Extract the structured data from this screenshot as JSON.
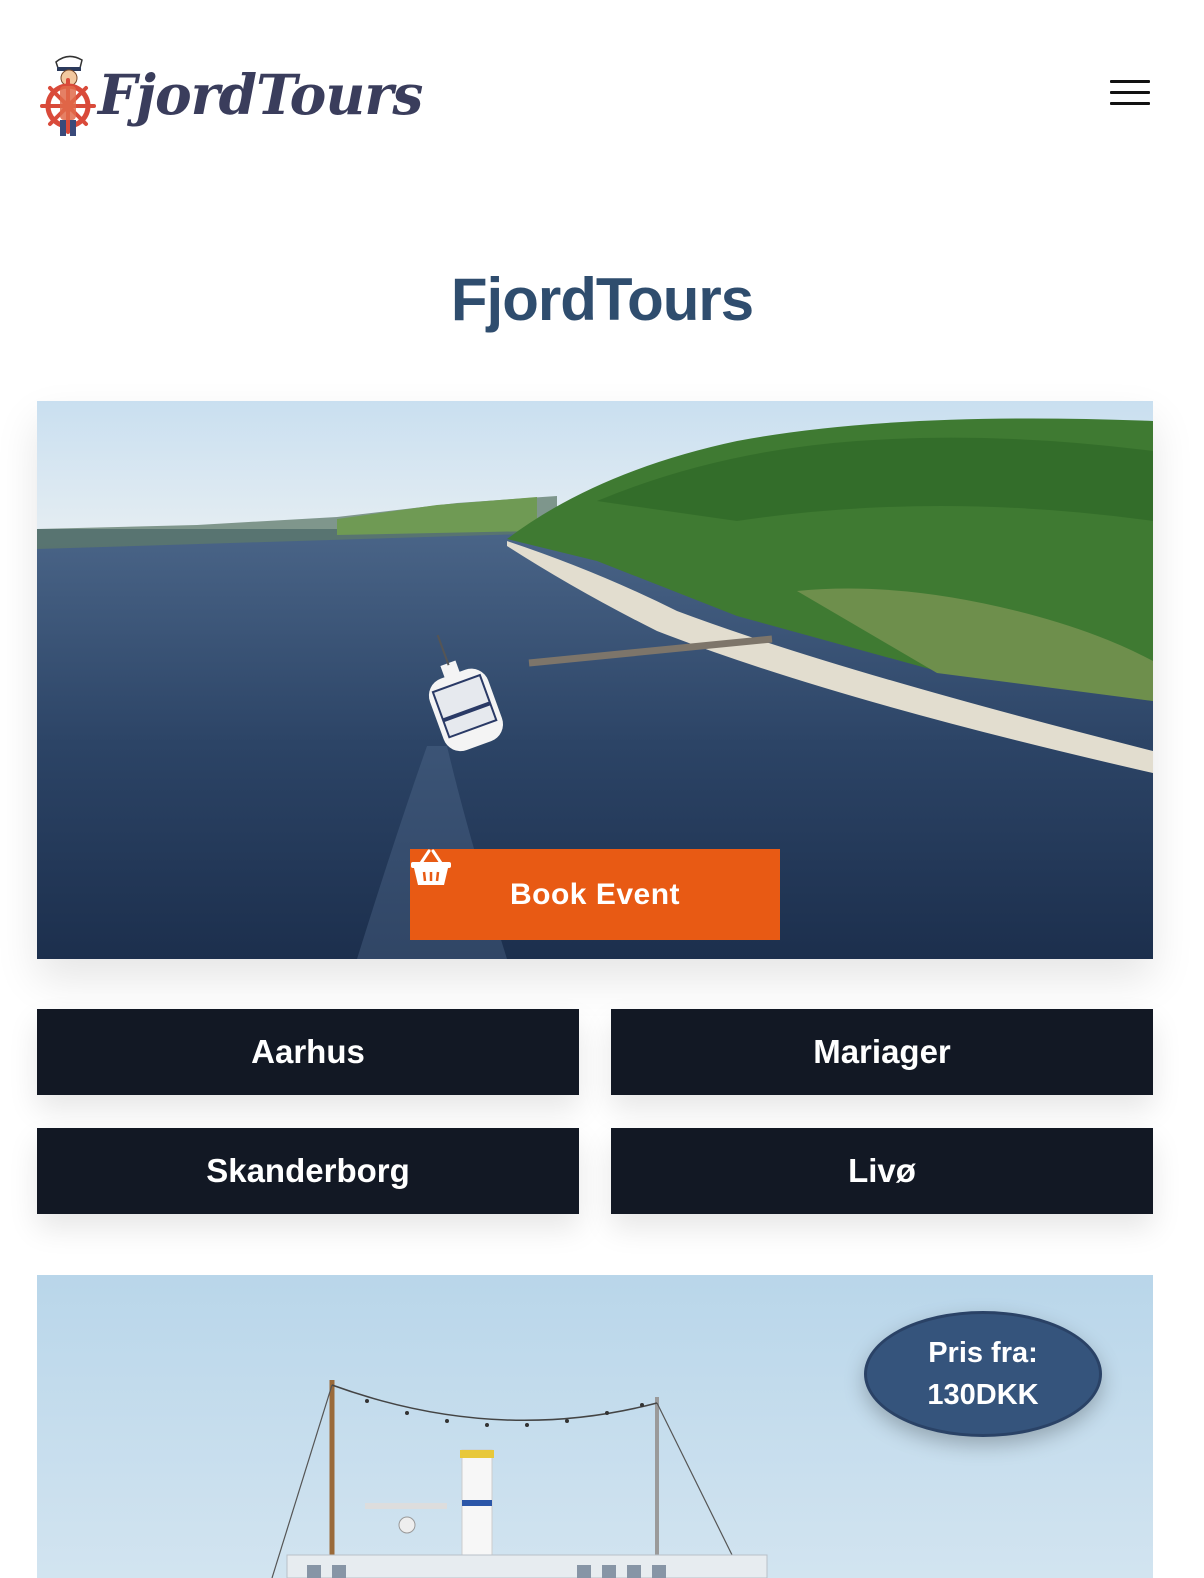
{
  "header": {
    "logo_text": "FjordTours",
    "menu_icon": "hamburger-menu-icon"
  },
  "page_title": "FjordTours",
  "hero": {
    "book_button_label": "Book Event",
    "book_button_icon": "shopping-basket-icon",
    "accent_color": "#e85a14"
  },
  "locations": [
    "Aarhus",
    "Mariager",
    "Skanderborg",
    "Livø"
  ],
  "tour_card": {
    "price_label": "Pris fra:",
    "price_value": "130DKK"
  }
}
